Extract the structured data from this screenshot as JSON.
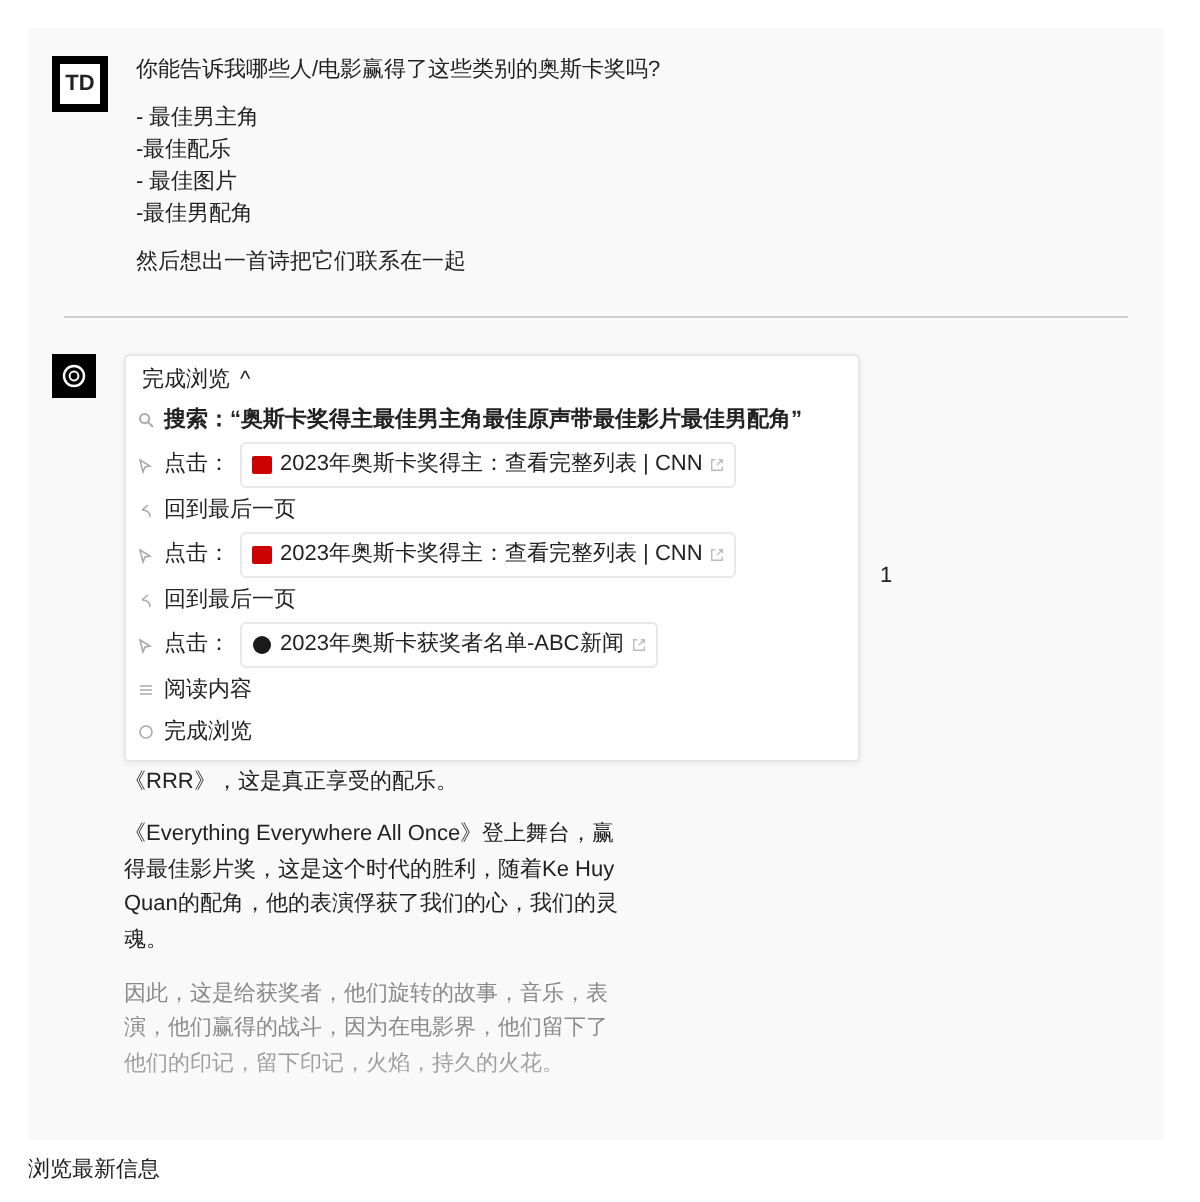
{
  "user_message": {
    "avatar": "TD",
    "paragraphs": [
      "你能告诉我哪些人/电影赢得了这些类别的奥斯卡奖吗?",
      "- 最佳男主角\n-最佳配乐\n- 最佳图片\n-最佳男配角",
      "然后想出一首诗把它们联系在一起"
    ]
  },
  "assistant_message": {
    "browsing": {
      "label": "完成浏览",
      "caret": "^",
      "expanded": true,
      "steps": [
        {
          "kind": "search",
          "text": "搜索：“奥斯卡奖得主最佳男主角最佳原声带最佳影片最佳男配角”"
        },
        {
          "kind": "click",
          "text": "点击：",
          "link": {
            "title": "2023年奥斯卡奖得主：查看完整列表 | CNN",
            "color": "#cc0000",
            "kind": "square"
          }
        },
        {
          "kind": "back",
          "text": "回到最后一页"
        },
        {
          "kind": "click",
          "text": "点击：",
          "link": {
            "title": "2023年奥斯卡奖得主：查看完整列表 | CNN",
            "color": "#cc0000",
            "kind": "square"
          }
        },
        {
          "kind": "back",
          "text": "回到最后一页"
        },
        {
          "kind": "click",
          "text": "点击：",
          "link": {
            "title": "2023年奥斯卡获奖者名单-ABC新闻",
            "color": "#1a1a1a",
            "kind": "circle"
          }
        },
        {
          "kind": "read",
          "text": "阅读内容"
        },
        {
          "kind": "done",
          "text": "完成浏览"
        }
      ]
    },
    "partial_text": "1",
    "paragraphs": [
      {
        "text": "《RRR》，这是真正享受的配乐。",
        "faded": false
      },
      {
        "text": "《Everything Everywhere All Once》登上舞台，赢得最佳影片奖，这是这个时代的胜利，随着Ke Huy Quan的配角，他的表演俘获了我们的心，我们的灵魂。",
        "faded": false
      },
      {
        "text": "因此，这是给获奖者，他们旋转的故事，音乐，表演，他们赢得的战斗，因为在电影界，他们留下了他们的印记，留下印记，火焰，持久的火花。",
        "faded": true
      }
    ]
  },
  "caption": "浏览最新信息"
}
